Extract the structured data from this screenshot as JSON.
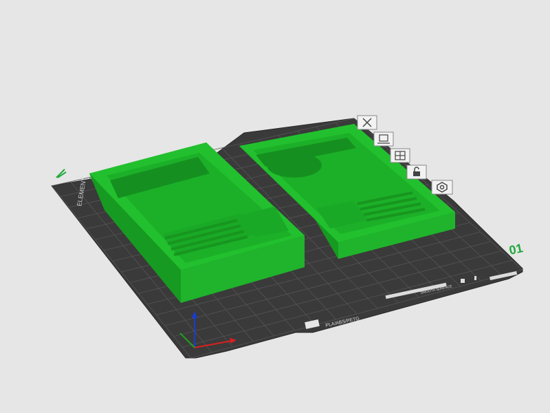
{
  "viewport": {
    "background_color": "#e6e6e6",
    "plate_color": "#3a3a3a",
    "grid_color": "#5a5a5a",
    "part_color": "#22c02e",
    "part_dark_color": "#179a21",
    "plate_number": "01",
    "plate_material_label": "PLA/ABS/PETG",
    "plate_smooth_label": "SMOOTH SURFACE",
    "plate_left_label": "ELEMENT",
    "axes": {
      "x_color": "#d92020",
      "y_color": "#20a020",
      "z_color": "#1a3ad6"
    }
  },
  "plate_toolbar": [
    {
      "name": "delete-plate-button",
      "icon": "close-icon"
    },
    {
      "name": "arrange-plate-button",
      "icon": "arrange-icon"
    },
    {
      "name": "orient-plate-button",
      "icon": "orient-icon"
    },
    {
      "name": "lock-plate-button",
      "icon": "lock-icon"
    },
    {
      "name": "plate-settings-button",
      "icon": "gear-icon"
    }
  ]
}
